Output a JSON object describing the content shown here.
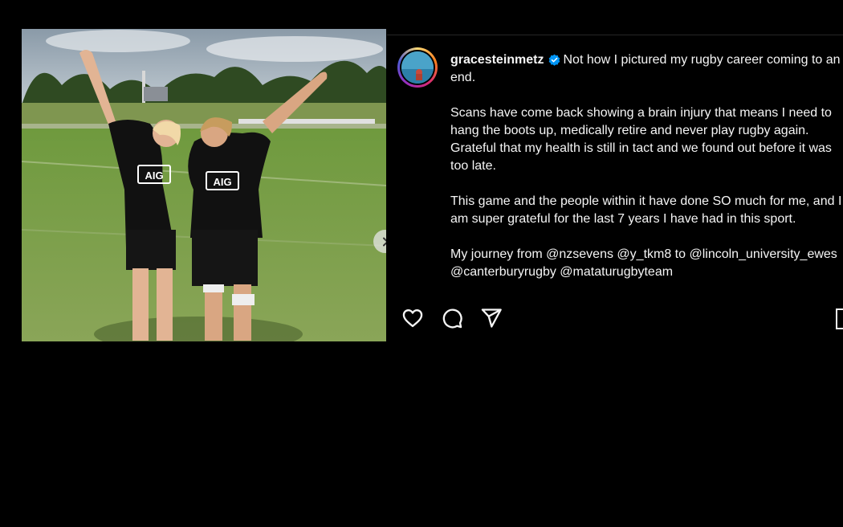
{
  "post": {
    "username": "gracesteinmetz",
    "caption_paragraphs": [
      "Not how I pictured my rugby career coming to an end.",
      "Scans have come back showing a brain injury that means I need to hang the boots up, medically retire and never play rugby again. Grateful that my health is still in tact and we found out before it was too late.",
      "This game and the people within it have done SO much for me, and I am super grateful for the last 7 years I have had in this sport.",
      "My journey from @nzsevens @y_tkm8 to @lincoln_university_ewes @canterburyrugby @mataturugbyteam"
    ],
    "photo_jersey_text": "AIG"
  },
  "icons": {
    "verified": "verified-badge-icon",
    "like": "heart-icon",
    "comment": "comment-icon",
    "share": "share-icon",
    "save": "bookmark-icon",
    "next": "chevron-right-icon"
  },
  "colors": {
    "background": "#000000",
    "text": "#f5f5f5",
    "verified": "#0095f6"
  }
}
